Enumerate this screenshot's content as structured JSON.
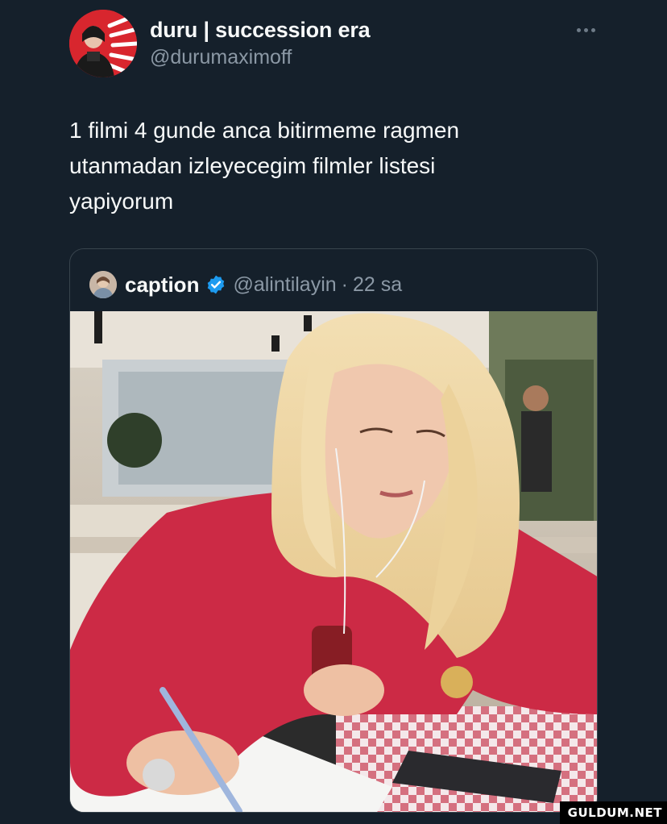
{
  "tweet": {
    "author": {
      "display_name": "duru | succession era",
      "handle": "@durumaximoff",
      "avatar_icon": "profile-avatar"
    },
    "more_icon": "ellipsis-icon",
    "text_lines": [
      "1 filmi 4 gunde anca bitirmeme ragmen",
      "utanmadan izleyecegim filmler listesi",
      "yapiyorum"
    ]
  },
  "quote": {
    "author": {
      "display_name": "caption",
      "handle": "@alintilayin",
      "separator": "·",
      "time": "22 sa",
      "verified_icon": "verified-badge-icon"
    },
    "photo": {
      "description_icon": "photo-woman-writing-icon"
    }
  },
  "watermark": "GULDUM.NET",
  "colors": {
    "background": "#15202b",
    "text_primary": "#f7f9f9",
    "text_secondary": "#8b98a5",
    "border": "#38444d",
    "verified": "#1d9bf0"
  }
}
